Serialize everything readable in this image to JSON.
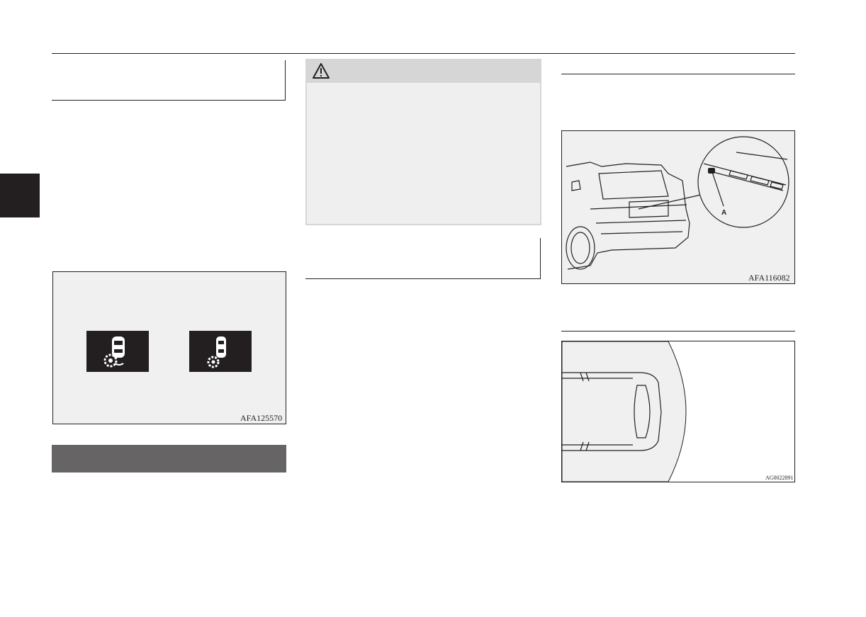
{
  "page": {
    "chapter_tab_color": "#231f20",
    "text_color": "#231f20",
    "figure_bg": "#f0f0f0",
    "section_band_color": "#666465"
  },
  "figures": {
    "display_icons": {
      "code": "AFA125570",
      "icons": [
        "car-sensor-fault-icon",
        "car-sensor-off-icon"
      ]
    },
    "warning_box": {
      "icon": "warning-triangle-icon"
    },
    "rear_view": {
      "code": "AFA116082",
      "callout": "A"
    },
    "top_view": {
      "code": "AG0022891"
    }
  }
}
